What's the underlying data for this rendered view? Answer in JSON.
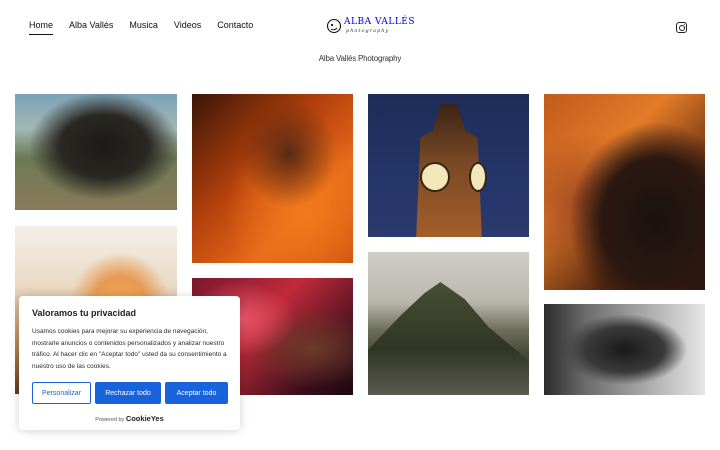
{
  "nav": {
    "items": [
      {
        "label": "Home",
        "active": true
      },
      {
        "label": "Alba Vallés"
      },
      {
        "label": "Musica"
      },
      {
        "label": "Videos"
      },
      {
        "label": "Contacto"
      }
    ]
  },
  "logo": {
    "name": "ALBA VALLÉS",
    "sub": "photography"
  },
  "social": {
    "icon": "instagram-icon"
  },
  "tagline": "Alba Vallés Photography",
  "cookie": {
    "title": "Valoramos tu privacidad",
    "text": "Usamos cookies para mejorar su experiencia de navegación, mostrarle anuncios o contenidos personalizados y analizar nuestro tráfico. Al hacer clic en \"Aceptar todo\" usted da su consentimiento a nuestro uso de las cookies.",
    "customize_label": "Personalizar",
    "reject_label": "Rechazar todo",
    "accept_label": "Aceptar todo",
    "powered_label": "Powered by",
    "brand": "CookieYes"
  },
  "colors": {
    "accent": "#1863dc"
  }
}
